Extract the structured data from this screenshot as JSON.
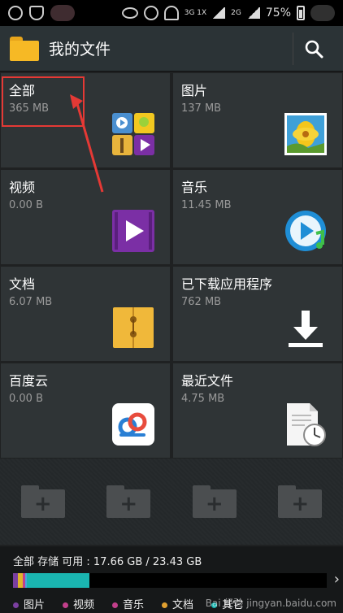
{
  "status_bar": {
    "network": "3G 1X",
    "network2": "2G",
    "battery": "75%",
    "time": ""
  },
  "app": {
    "title": "我的文件"
  },
  "tiles": [
    {
      "name": "全部",
      "size": "365 MB",
      "icon": "all-files-icon"
    },
    {
      "name": "图片",
      "size": "137 MB",
      "icon": "image-icon"
    },
    {
      "name": "视频",
      "size": "0.00 B",
      "icon": "video-icon"
    },
    {
      "name": "音乐",
      "size": "11.45 MB",
      "icon": "music-icon"
    },
    {
      "name": "文档",
      "size": "6.07 MB",
      "icon": "document-icon"
    },
    {
      "name": "已下载应用程序",
      "size": "762 MB",
      "icon": "download-icon"
    },
    {
      "name": "百度云",
      "size": "0.00 B",
      "icon": "baidu-cloud-icon"
    },
    {
      "name": "最近文件",
      "size": "4.75 MB",
      "icon": "recent-files-icon"
    }
  ],
  "storage": {
    "label": "全部 存储 可用 : 17.66 GB / 23.43 GB",
    "used_fraction": 0.246,
    "segments": [
      {
        "name": "图片",
        "color": "#7b3fa0",
        "fraction": 0.015
      },
      {
        "name": "其它",
        "color": "#e0b52a",
        "fraction": 0.015
      },
      {
        "name": "视频",
        "color": "#c23f8b",
        "fraction": 0.008
      },
      {
        "name": "音乐",
        "color": "#4aa3df",
        "fraction": 0.005
      },
      {
        "name": "文档",
        "color": "#1ab5b0",
        "fraction": 0.2
      }
    ],
    "legend": [
      {
        "label": "图片",
        "color": "#7b3fa0"
      },
      {
        "label": "视频",
        "color": "#c23f8b"
      },
      {
        "label": "音乐",
        "color": "#c23f8b"
      },
      {
        "label": "文档",
        "color": "#e0a030"
      },
      {
        "label": "其它",
        "color": "#1ab5b0"
      }
    ]
  },
  "watermark": "Bai 经验 jingyan.baidu.com"
}
